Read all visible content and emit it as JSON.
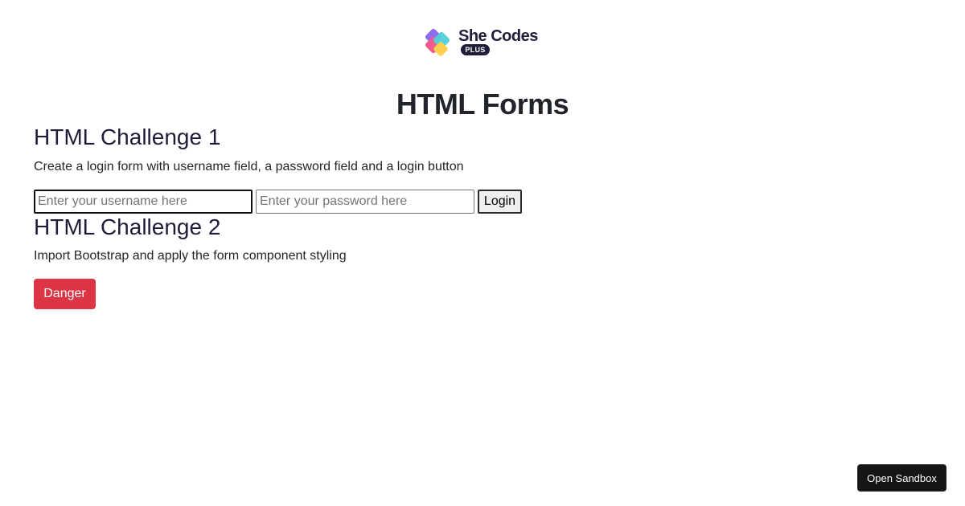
{
  "logo": {
    "text": "She Codes",
    "badge": "PLUS",
    "colors": [
      "#8e6cf0",
      "#f25a8f",
      "#4fd1d9",
      "#ffcf4d"
    ]
  },
  "page": {
    "title": "HTML Forms"
  },
  "challenges": [
    {
      "heading": "HTML Challenge 1",
      "description": "Create a login form with username field, a password field and a login button"
    },
    {
      "heading": "HTML Challenge 2",
      "description": "Import Bootstrap and apply the form component styling"
    }
  ],
  "login_form": {
    "username_placeholder": "Enter your username here",
    "username_value": "",
    "password_placeholder": "Enter your password here",
    "password_value": "",
    "login_label": "Login"
  },
  "danger_button": {
    "label": "Danger",
    "color": "#dc3545"
  },
  "sandbox_button": {
    "label": "Open Sandbox"
  }
}
